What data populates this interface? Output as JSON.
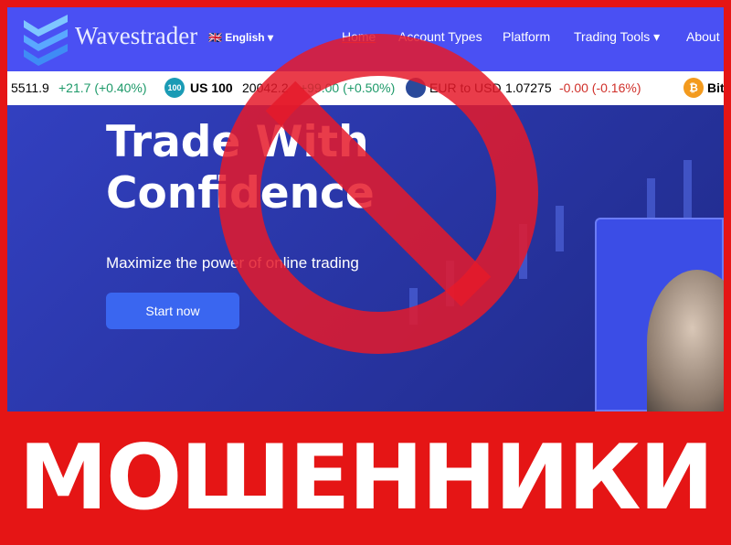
{
  "header": {
    "brand": "Wavestrader",
    "language": "English",
    "nav": [
      "Home",
      "Account Types",
      "Platform",
      "Trading Tools",
      "About"
    ]
  },
  "ticker": [
    {
      "value": "5511.9",
      "change": "+21.7 (+0.40%)",
      "dir": "up"
    },
    {
      "icon": "100",
      "name": "US 100",
      "value": "20042.2",
      "change": "+99.00 (+0.50%)",
      "dir": "up"
    },
    {
      "name": "EUR to USD",
      "value": "1.07275",
      "change": "-0.00 (-0.16%)",
      "dir": "down"
    },
    {
      "icon": "₿",
      "name": "Bit"
    }
  ],
  "hero": {
    "title_line1": "Trade With",
    "title_line2": "Confidence",
    "subtitle": "Maximize the power of online trading",
    "cta": "Start now"
  },
  "banner": {
    "text": "МОШЕННИКИ"
  },
  "colors": {
    "header": "#4a50f3",
    "banner": "#e51515",
    "prohibition": "#e51a2a",
    "up": "#1e9a6a",
    "down": "#d0302a"
  }
}
